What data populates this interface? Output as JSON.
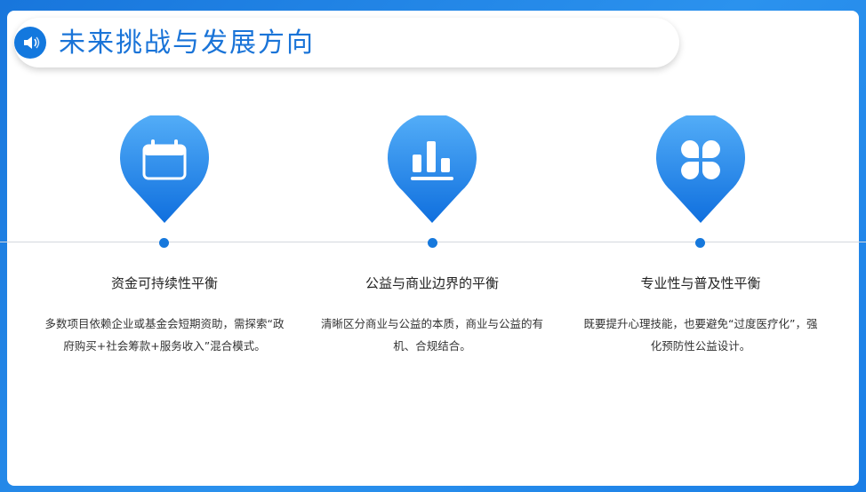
{
  "header": {
    "title": "未来挑战与发展方向",
    "icon": "speaker-icon"
  },
  "colors": {
    "brand_blue": "#1678dc",
    "frame_blue": "#1a7fe0",
    "timeline": "#d4d8de"
  },
  "items": [
    {
      "icon": "calendar-icon",
      "title": "资金可持续性平衡",
      "desc": "多数项目依赖企业或基金会短期资助，需探索“政府购买+社会筹款+服务收入”混合模式。"
    },
    {
      "icon": "bar-chart-icon",
      "title": "公益与商业边界的平衡",
      "desc": "清晰区分商业与公益的本质，商业与公益的有机、合规结合。"
    },
    {
      "icon": "four-petal-icon",
      "title": "专业性与普及性平衡",
      "desc": "既要提升心理技能，也要避免“过度医疗化”，强化预防性公益设计。"
    }
  ]
}
